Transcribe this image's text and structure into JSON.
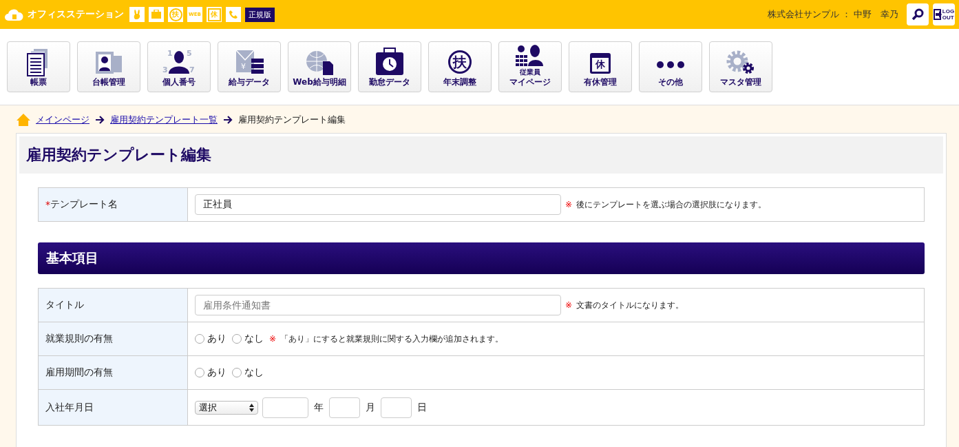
{
  "header": {
    "brand": "オフィスステーション",
    "quick_icons": [
      {
        "kind": "rabbit"
      },
      {
        "kind": "briefcase"
      },
      {
        "kind": "circle",
        "glyph": "扶"
      },
      {
        "kind": "web",
        "glyph": "WEB"
      },
      {
        "kind": "square",
        "glyph": "休"
      },
      {
        "kind": "phone"
      }
    ],
    "edition_badge": "正規版",
    "user": "株式会社サンプル ： 中野　幸乃",
    "logout": [
      "LOG",
      "OUT"
    ]
  },
  "nav": [
    {
      "label": "帳票",
      "kind": "doc"
    },
    {
      "label": "台帳管理",
      "kind": "ledger"
    },
    {
      "label": "個人番号",
      "kind": "number",
      "glyphs": [
        "1",
        "5",
        "3",
        "7"
      ]
    },
    {
      "label": "給与データ",
      "kind": "payroll",
      "glyph": "¥"
    },
    {
      "label": "Web給与明細",
      "kind": "globe"
    },
    {
      "label": "勤怠データ",
      "kind": "clock"
    },
    {
      "label": "年末調整",
      "kind": "circle",
      "glyph": "扶"
    },
    {
      "label_lines": [
        "従業員",
        "マイページ"
      ],
      "kind": "mypage"
    },
    {
      "label": "有休管理",
      "kind": "calendar",
      "glyph": "休"
    },
    {
      "label": "その他",
      "kind": "dots"
    },
    {
      "label": "マスタ管理",
      "kind": "gears"
    }
  ],
  "breadcrumb": [
    {
      "label": "メインページ",
      "link": true
    },
    {
      "label": "雇用契約テンプレート一覧",
      "link": true
    },
    {
      "label": "雇用契約テンプレート編集",
      "link": false
    }
  ],
  "page_title": "雇用契約テンプレート編集",
  "template_row": {
    "required_mark": "*",
    "label": "テンプレート名",
    "value": "正社員",
    "note_mark": "※",
    "note": "後にテンプレートを選ぶ場合の選択肢になります。"
  },
  "section_title": "基本項目",
  "rows": [
    {
      "kind": "text",
      "label": "タイトル",
      "placeholder": "雇用条件通知書",
      "note_mark": "※",
      "note": "文書のタイトルになります。"
    },
    {
      "kind": "radio",
      "label": "就業規則の有無",
      "options": [
        {
          "label": "あり",
          "selected": false
        },
        {
          "label": "なし",
          "selected": false
        }
      ],
      "note_mark": "※",
      "note": "「あり」にすると就業規則に関する入力欄が追加されます。"
    },
    {
      "kind": "radio",
      "label": "雇用期間の有無",
      "options": [
        {
          "label": "あり",
          "selected": false
        },
        {
          "label": "なし",
          "selected": false
        }
      ]
    },
    {
      "kind": "date",
      "label": "入社年月日",
      "select": "選択",
      "units": [
        "年",
        "月",
        "日"
      ]
    }
  ]
}
